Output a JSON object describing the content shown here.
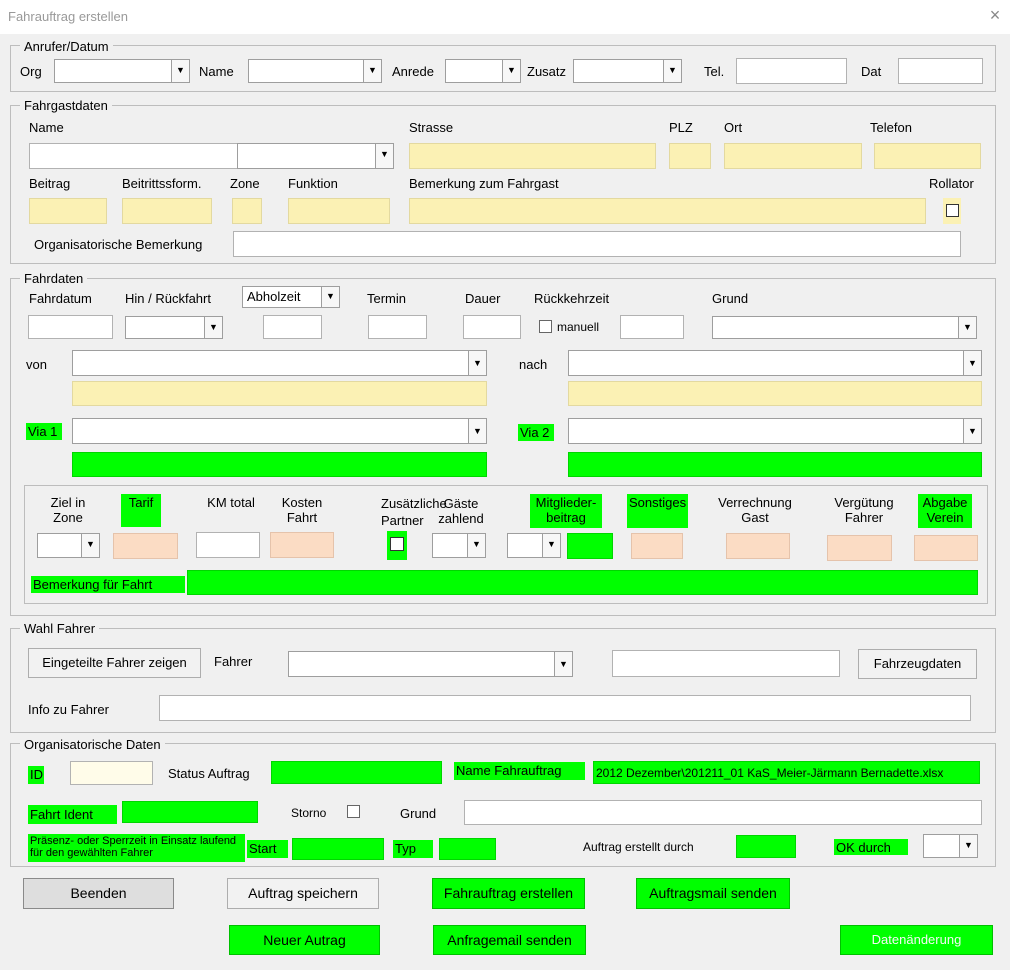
{
  "window": {
    "title": "Fahrauftrag erstellen",
    "close_icon": "×"
  },
  "icons": {
    "dropdown": "▼"
  },
  "anrufer": {
    "legend": "Anrufer/Datum",
    "org_label": "Org",
    "name_label": "Name",
    "anrede_label": "Anrede",
    "zusatz_label": "Zusatz",
    "tel_label": "Tel.",
    "dat_label": "Dat",
    "org_value": "",
    "name_value": "",
    "anrede_value": "",
    "zusatz_value": "",
    "tel_value": "",
    "dat_value": ""
  },
  "fahrgast": {
    "legend": "Fahrgastdaten",
    "name_label": "Name",
    "strasse_label": "Strasse",
    "plz_label": "PLZ",
    "ort_label": "Ort",
    "telefon_label": "Telefon",
    "beitrag_label": "Beitrag",
    "beitrittsform_label": "Beitrittssform.",
    "zone_label": "Zone",
    "funktion_label": "Funktion",
    "bemerkung_label": "Bemerkung zum Fahrgast",
    "rollator_label": "Rollator",
    "org_bemerkung_label": "Organisatorische Bemerkung",
    "name_value": "",
    "strasse_value": "",
    "plz_value": "",
    "ort_value": "",
    "telefon_value": ""
  },
  "fahrdaten": {
    "legend": "Fahrdaten",
    "fahrdatum_label": "Fahrdatum",
    "hin_rueck_label": "Hin / Rückfahrt",
    "abholzeit_option": "Abholzeit",
    "termin_label": "Termin",
    "dauer_label": "Dauer",
    "rueckkehrzeit_label": "Rückkehrzeit",
    "manuell_label": "manuell",
    "grund_label": "Grund",
    "von_label": "von",
    "nach_label": "nach",
    "via1_label": "Via 1",
    "via2_label": "Via 2",
    "ziel_label": "Ziel in Zone",
    "tarif_label": "Tarif",
    "km_label": "KM total",
    "kosten_label": "Kosten Fahrt",
    "zusaetzliche_label": "Zusätzliche",
    "partner_label": "Partner",
    "gaeste_label": "Gäste zahlend",
    "mitglieder_label": "Mitglieder-beitrag",
    "sonstiges_label": "Sonstiges",
    "verrechnung_label": "Verrechnung Gast",
    "verguetung_label": "Vergütung Fahrer",
    "abgabe_label": "Abgabe Verein",
    "bemerkung_fahrt_label": "Bemerkung für Fahrt"
  },
  "fahrer": {
    "legend": "Wahl Fahrer",
    "zeigen_button": "Eingeteilte Fahrer zeigen",
    "fahrer_label": "Fahrer",
    "fahrzeug_button": "Fahrzeugdaten",
    "info_label": "Info zu Fahrer"
  },
  "org": {
    "legend": "Organisatorische Daten",
    "id_label": "ID",
    "status_label": "Status Auftrag",
    "name_fahrauftrag_label": "Name Fahrauftrag",
    "name_fahrauftrag_value": "2012 Dezember\\201211_01 KaS_Meier-Järmann Bernadette.xlsx",
    "fahrt_ident_label": "Fahrt Ident",
    "storno_label": "Storno",
    "grund_label": "Grund",
    "praesenz_label": "Präsenz- oder Sperrzeit in Einsatz laufend für den gewählten Fahrer",
    "start_label": "Start",
    "typ_label": "Typ",
    "erstellt_label": "Auftrag erstellt durch",
    "ok_label": "OK durch"
  },
  "buttons": {
    "beenden": "Beenden",
    "speichern": "Auftrag speichern",
    "erstellen": "Fahrauftrag erstellen",
    "mail_senden": "Auftragsmail senden",
    "neuer": "Neuer Autrag",
    "anfrage": "Anfragemail senden",
    "datenaenderung": "Datenänderung"
  },
  "colors": {
    "highlight_green": "#00ff00",
    "input_yellow": "#fbf1b4",
    "input_peach": "#fbdcc4"
  }
}
